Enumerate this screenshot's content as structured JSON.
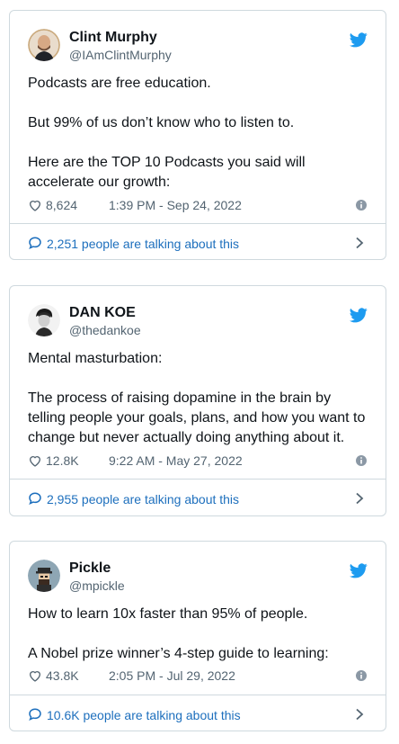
{
  "colors": {
    "link": "#1d6fbd",
    "twitter_blue": "#1d9bf0",
    "muted": "#536471",
    "border": "#cfd9de"
  },
  "tweets": [
    {
      "name": "Clint Murphy",
      "handle": "@IAmClintMurphy",
      "paragraphs": [
        "Podcasts are free education.",
        "But 99% of us don’t know who to listen to.",
        "Here are the TOP 10 Podcasts you said will accelerate our growth:"
      ],
      "likes": "8,624",
      "time": "1:39 PM - Sep 24, 2022",
      "talking": "2,251 people are talking about this"
    },
    {
      "name": "DAN KOE",
      "handle": "@thedankoe",
      "paragraphs": [
        "Mental masturbation:",
        "The process of raising dopamine in the brain by telling people your goals, plans, and how you want to change but never actually doing anything about it."
      ],
      "likes": "12.8K",
      "time": "9:22 AM - May 27, 2022",
      "talking": "2,955 people are talking about this"
    },
    {
      "name": "Pickle",
      "handle": "@mpickle",
      "paragraphs": [
        "How to learn 10x faster than 95% of people.",
        "A Nobel prize winner’s 4-step guide to learning:"
      ],
      "likes": "43.8K",
      "time": "2:05 PM - Jul 29, 2022",
      "talking": "10.6K people are talking about this"
    }
  ]
}
